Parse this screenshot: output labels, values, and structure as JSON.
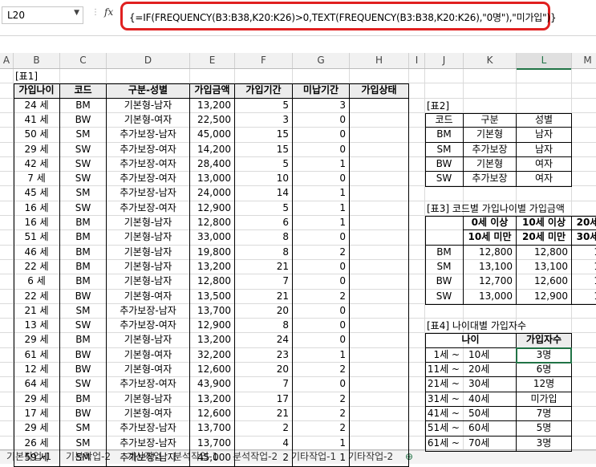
{
  "formula_bar": {
    "cell_ref": "L20",
    "fx_label": "fx",
    "formula": "{=IF(FREQUENCY(B3:B38,K20:K26)>0,TEXT(FREQUENCY(B3:B38,K20:K26),\"0명\"),\"미가입\")}"
  },
  "columns": [
    "A",
    "B",
    "C",
    "D",
    "E",
    "F",
    "G",
    "H",
    "I",
    "J",
    "K",
    "L",
    "M"
  ],
  "selected_column": "L",
  "table1": {
    "title": "[표1]",
    "headers": [
      "가입나이",
      "코드",
      "구분-성별",
      "가입금액",
      "가입기간",
      "미납기간",
      "가입상태"
    ],
    "rows": [
      [
        "24 세",
        "BM",
        "기본형-남자",
        "13,200",
        "5",
        "3"
      ],
      [
        "41 세",
        "BW",
        "기본형-여자",
        "22,500",
        "3",
        "0"
      ],
      [
        "50 세",
        "SM",
        "추가보장-남자",
        "45,000",
        "15",
        "0"
      ],
      [
        "29 세",
        "SW",
        "추가보장-여자",
        "14,200",
        "15",
        "0"
      ],
      [
        "42 세",
        "SW",
        "추가보장-여자",
        "28,400",
        "5",
        "1"
      ],
      [
        "7 세",
        "SW",
        "추가보장-여자",
        "13,000",
        "10",
        "0"
      ],
      [
        "45 세",
        "SM",
        "추가보장-남자",
        "24,000",
        "14",
        "1"
      ],
      [
        "16 세",
        "SW",
        "추가보장-여자",
        "12,900",
        "5",
        "1"
      ],
      [
        "16 세",
        "BM",
        "기본형-남자",
        "12,800",
        "6",
        "1"
      ],
      [
        "51 세",
        "BM",
        "기본형-남자",
        "33,000",
        "8",
        "0"
      ],
      [
        "46 세",
        "BM",
        "기본형-남자",
        "19,800",
        "8",
        "2"
      ],
      [
        "22 세",
        "BM",
        "기본형-남자",
        "13,200",
        "21",
        "0"
      ],
      [
        "6 세",
        "BM",
        "기본형-남자",
        "12,800",
        "7",
        "0"
      ],
      [
        "22 세",
        "BW",
        "기본형-여자",
        "13,500",
        "21",
        "2"
      ],
      [
        "21 세",
        "SM",
        "추가보장-남자",
        "13,700",
        "20",
        "0"
      ],
      [
        "13 세",
        "SW",
        "추가보장-여자",
        "12,900",
        "8",
        "0"
      ],
      [
        "29 세",
        "BM",
        "기본형-남자",
        "13,200",
        "24",
        "0"
      ],
      [
        "61 세",
        "BW",
        "기본형-여자",
        "32,200",
        "23",
        "1"
      ],
      [
        "12 세",
        "BW",
        "기본형-여자",
        "12,600",
        "20",
        "2"
      ],
      [
        "64 세",
        "SW",
        "추가보장-여자",
        "43,900",
        "7",
        "0"
      ],
      [
        "29 세",
        "BM",
        "기본형-남자",
        "13,200",
        "17",
        "2"
      ],
      [
        "17 세",
        "BW",
        "기본형-여자",
        "12,600",
        "21",
        "2"
      ],
      [
        "29 세",
        "SM",
        "추가보장-남자",
        "13,700",
        "2",
        "2"
      ],
      [
        "26 세",
        "SM",
        "추가보장-남자",
        "13,700",
        "4",
        "1"
      ],
      [
        "59 세",
        "SM",
        "추가보장-남자",
        "45,000",
        "2",
        "1"
      ]
    ]
  },
  "table2": {
    "title": "[표2]",
    "headers": [
      "코드",
      "구분",
      "성별"
    ],
    "rows": [
      [
        "BM",
        "기본형",
        "남자"
      ],
      [
        "SM",
        "추가보장",
        "남자"
      ],
      [
        "BW",
        "기본형",
        "여자"
      ],
      [
        "SW",
        "추가보장",
        "여자"
      ]
    ]
  },
  "table3": {
    "title": "[표3] 코드별 가입나이별 가입금액",
    "header_row1": [
      "0세 이상",
      "10세 이상",
      "20세"
    ],
    "header_row2": [
      "10세 미만",
      "20세 미만",
      "30세"
    ],
    "rows": [
      [
        "BM",
        "12,800",
        "12,800",
        "1"
      ],
      [
        "SM",
        "13,100",
        "13,100",
        "1"
      ],
      [
        "BW",
        "12,700",
        "12,600",
        "1"
      ],
      [
        "SW",
        "13,000",
        "12,900",
        "1"
      ]
    ]
  },
  "table4": {
    "title": "[표4] 나이대별 가입자수",
    "headers": [
      "나이",
      "가입자수"
    ],
    "rows": [
      [
        "1세 ~",
        "10세",
        "3명"
      ],
      [
        "11세 ~",
        "20세",
        "6명"
      ],
      [
        "21세 ~",
        "30세",
        "12명"
      ],
      [
        "31세 ~",
        "40세",
        "미가입"
      ],
      [
        "41세 ~",
        "50세",
        "7명"
      ],
      [
        "51세 ~",
        "60세",
        "5명"
      ],
      [
        "61세 ~",
        "70세",
        "3명"
      ]
    ]
  },
  "sheet_tabs": [
    "기본작업-1",
    "기본작업-2",
    "계산작업",
    "분석작업-1",
    "분석작업-2",
    "기타작업-1",
    "기타작업-2"
  ]
}
